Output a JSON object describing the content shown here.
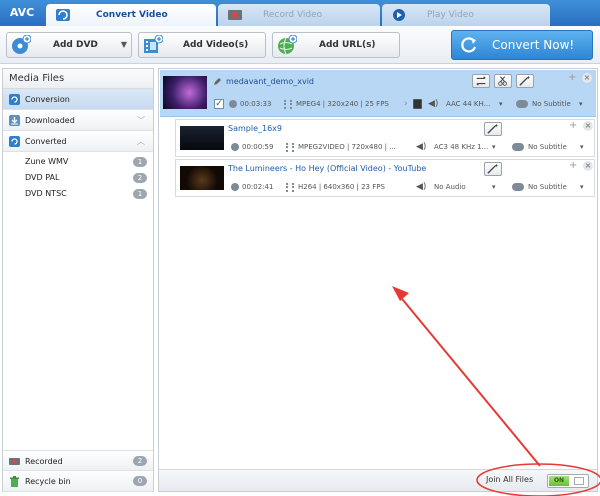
{
  "app": {
    "logo": "AVC"
  },
  "tabs": [
    {
      "label": "Convert Video",
      "active": true
    },
    {
      "label": "Record Video",
      "active": false
    },
    {
      "label": "Play Video",
      "active": false
    }
  ],
  "toolbar": {
    "add_dvd": "Add DVD",
    "add_videos": "Add Video(s)",
    "add_urls": "Add URL(s)",
    "convert_now": "Convert Now!"
  },
  "sidebar": {
    "title": "Media Files",
    "conversion": "Conversion",
    "downloaded": "Downloaded",
    "converted": "Converted",
    "converted_items": [
      {
        "label": "Zune WMV",
        "count": "1"
      },
      {
        "label": "DVD PAL",
        "count": "2"
      },
      {
        "label": "DVD NTSC",
        "count": "1"
      }
    ],
    "recorded": {
      "label": "Recorded",
      "count": "2"
    },
    "recycle": {
      "label": "Recycle bin",
      "count": "0"
    }
  },
  "files": {
    "main": {
      "title": "medavant_demo_xvid",
      "duration": "00:03:33",
      "video": "MPEG4 | 320x240 | 25 FPS",
      "audio": "AAC 44 KH...",
      "subtitle": "No Subtitle"
    },
    "children": [
      {
        "title": "Sample_16x9",
        "duration": "00:00:59",
        "video": "MPEG2VIDEO | 720x480 | ...",
        "audio": "AC3 48 KHz 1...",
        "subtitle": "No Subtitle"
      },
      {
        "title": "The Lumineers - Ho Hey (Official Video) - YouTube",
        "duration": "00:02:41",
        "video": "H264 | 640x360 | 23 FPS",
        "audio": "No Audio",
        "subtitle": "No Subtitle"
      }
    ]
  },
  "footer": {
    "join_label": "Join All Files",
    "toggle_on": "ON"
  },
  "colors": {
    "accent": "#2d86d6",
    "highlight_row": "#b7d7f5",
    "annotation": "#e53935"
  }
}
